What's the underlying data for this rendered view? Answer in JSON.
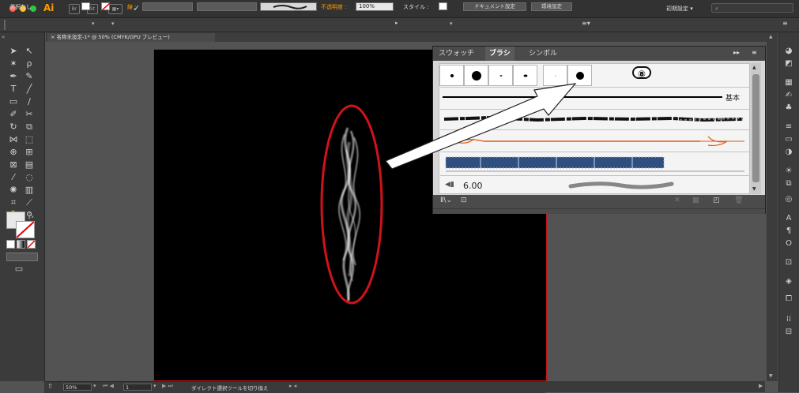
{
  "app": {
    "logo": "Ai"
  },
  "appbar": {
    "workspace": "初期設定 ▾",
    "search_placeholder": "⌕",
    "icons": [
      "bridge-icon",
      "stock-icon",
      "arrange-documents-icon",
      "gpu-icon"
    ]
  },
  "controlbar": {
    "selection_label": "選択なし",
    "stroke_label": "線 :",
    "opacity_label": "不透明度 :",
    "opacity_value": "100%",
    "style_label": "スタイル :",
    "doc_settings_button": "ドキュメント設定",
    "preferences_button": "環境設定"
  },
  "document": {
    "tab_title": "名称未設定-1* @ 50% (CMYK/GPU プレビュー)"
  },
  "brush_panel": {
    "tabs": [
      {
        "label": "スウォッチ",
        "active": false
      },
      {
        "label": "ブラシ",
        "active": true
      },
      {
        "label": "シンボル",
        "active": false
      }
    ],
    "basic_label": "基本",
    "brush_size": "6.00",
    "annotation_number": "⑧"
  },
  "status": {
    "zoom": "50%",
    "page": "1",
    "message": "ダイレクト選択ツールを切り換え"
  },
  "colors": {
    "accent_orange": "#ff9a00",
    "highlight_red": "#d0121b",
    "artboard_border": "#c21414"
  }
}
